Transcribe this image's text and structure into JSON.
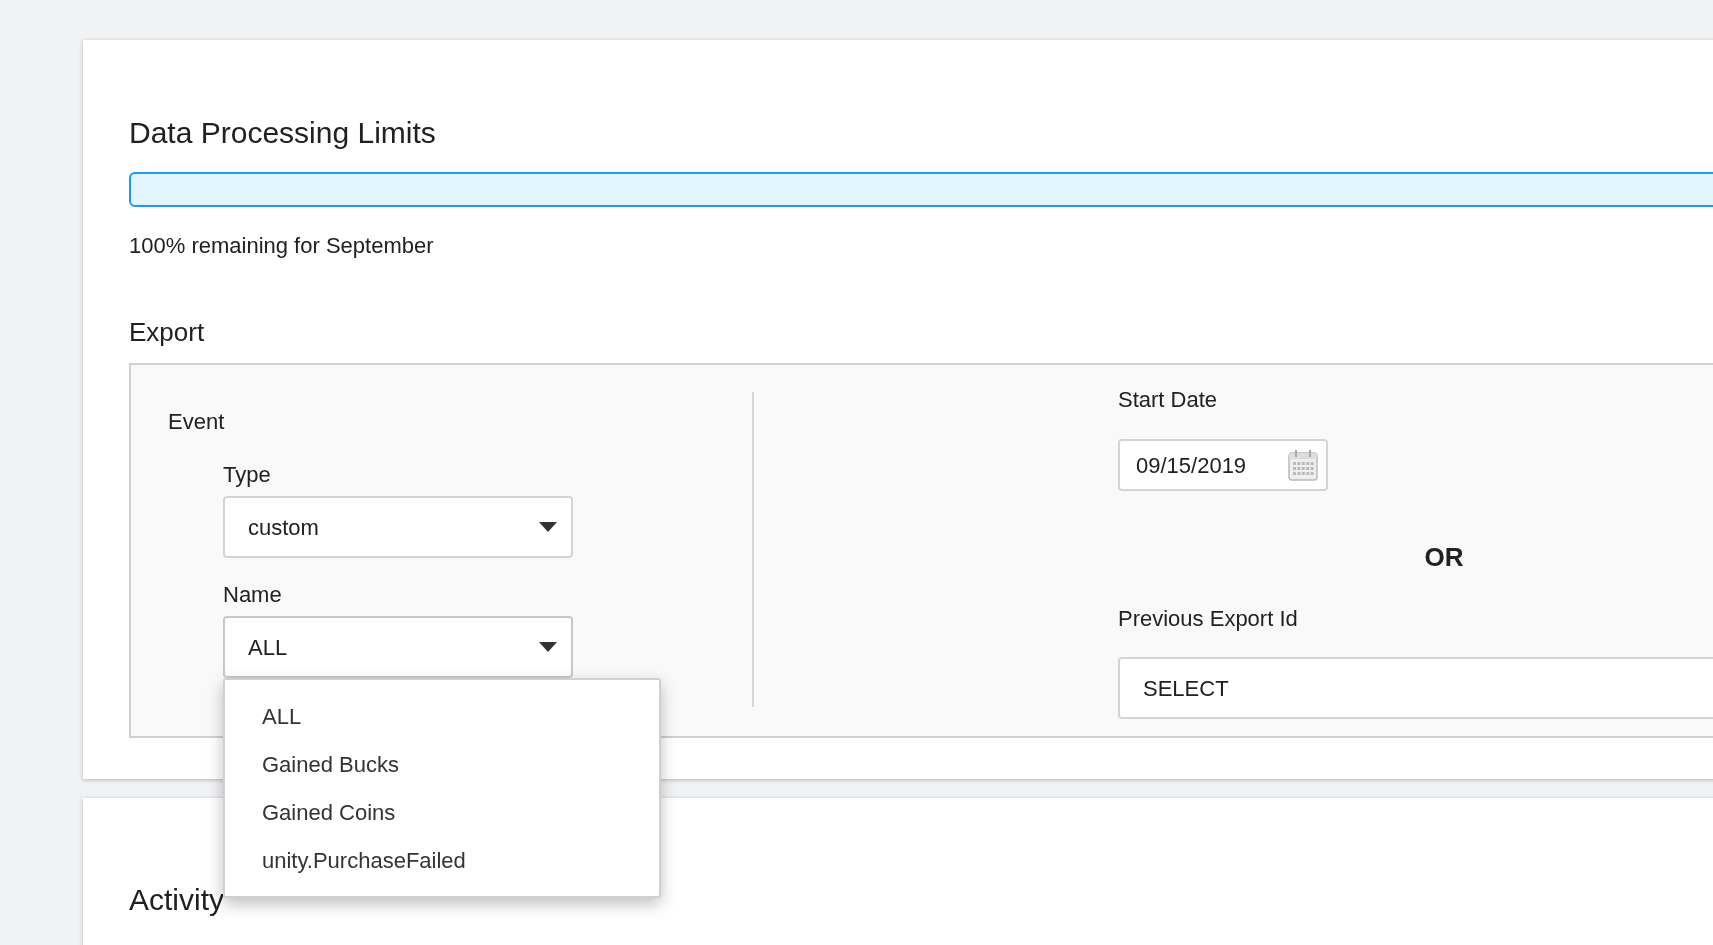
{
  "title": "Data Processing Limits",
  "usage": {
    "level": 0,
    "caption": "100% remaining for September"
  },
  "export": {
    "title": "Export",
    "event": {
      "label": "Event",
      "fields": [
        {
          "label": "Type",
          "value": "custom",
          "expanded": false
        },
        {
          "label": "Name",
          "value": "ALL",
          "expanded": true
        }
      ]
    },
    "menu": [
      {
        "label": "ALL"
      },
      {
        "label": "Gained Bucks"
      },
      {
        "label": "Gained Coins"
      },
      {
        "label": "unity.PurchaseFailed"
      }
    ],
    "start_date": {
      "label": "Start Date",
      "value": "09/15/2019"
    },
    "separator": "OR",
    "previous_export": {
      "label": "Previous Export Id",
      "value": "SELECT"
    }
  },
  "next_section": {
    "title": "Activity"
  }
}
